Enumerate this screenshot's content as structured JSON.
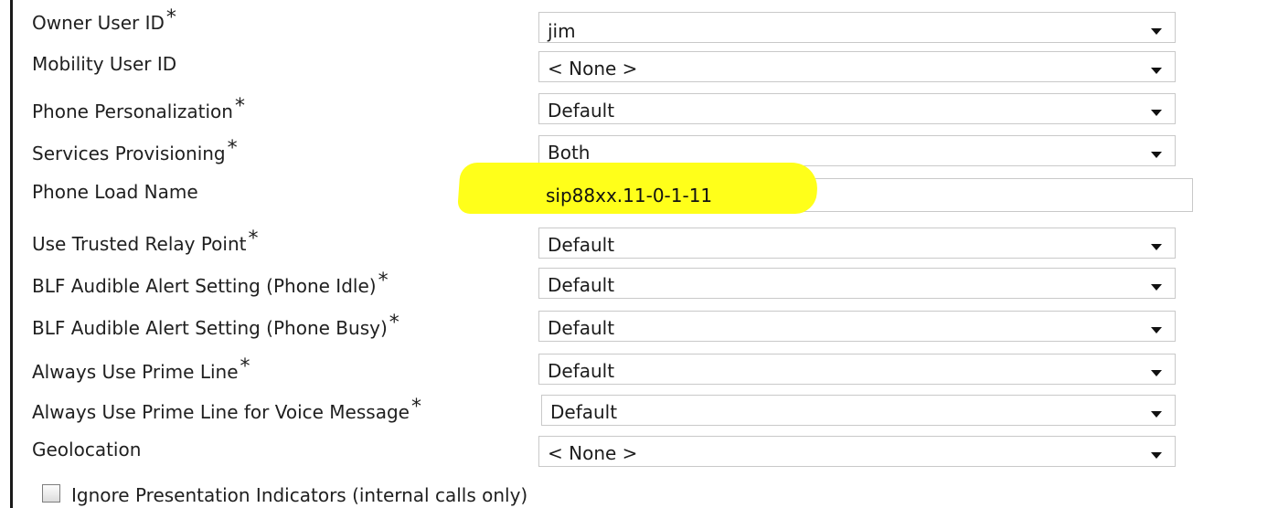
{
  "form": {
    "rows": [
      {
        "label": "Owner User ID",
        "required": true,
        "value": "jim",
        "control": "select"
      },
      {
        "label": "Mobility User ID",
        "required": false,
        "value": "< None >",
        "control": "select"
      },
      {
        "label": "Phone Personalization",
        "required": true,
        "value": "Default",
        "control": "select"
      },
      {
        "label": "Services Provisioning",
        "required": true,
        "value": "Both",
        "control": "select"
      },
      {
        "label": "Phone Load Name",
        "required": false,
        "value": "sip88xx.11-0-1-11",
        "control": "text"
      },
      {
        "label": "Use Trusted Relay Point",
        "required": true,
        "value": "Default",
        "control": "select"
      },
      {
        "label": "BLF Audible Alert Setting (Phone Idle)",
        "required": true,
        "value": "Default",
        "control": "select"
      },
      {
        "label": "BLF Audible Alert Setting (Phone Busy)",
        "required": true,
        "value": "Default",
        "control": "select"
      },
      {
        "label": "Always Use Prime Line",
        "required": true,
        "value": "Default",
        "control": "select"
      },
      {
        "label": "Always Use Prime Line for Voice Message",
        "required": true,
        "value": "Default",
        "control": "select"
      },
      {
        "label": "Geolocation",
        "required": false,
        "value": "< None >",
        "control": "select"
      }
    ],
    "required_mark": "*",
    "checkbox": {
      "label": "Ignore Presentation Indicators (internal calls only)",
      "checked": false
    }
  },
  "colors": {
    "highlight": "#ffff1a",
    "border": "#c9c9c9"
  }
}
